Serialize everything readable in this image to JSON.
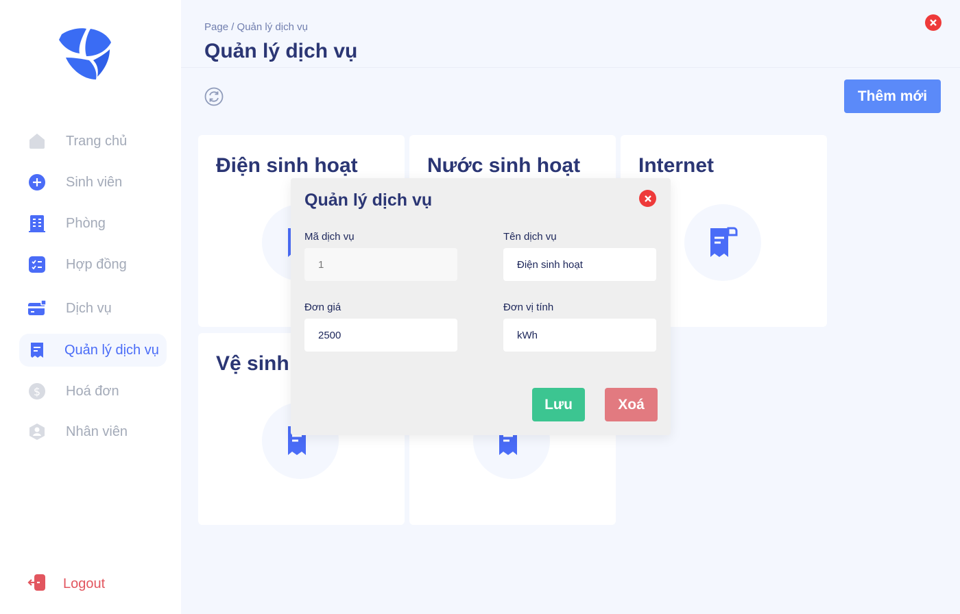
{
  "sidebar": {
    "items": [
      {
        "label": "Trang chủ",
        "icon": "home-icon"
      },
      {
        "label": "Sinh viên",
        "icon": "plus-circle-icon"
      },
      {
        "label": "Phòng",
        "icon": "building-icon"
      },
      {
        "label": "Hợp đồng",
        "icon": "checklist-icon"
      },
      {
        "label": "Dịch vụ",
        "icon": "card-icon"
      },
      {
        "label": "Quản lý dịch vụ",
        "icon": "receipt-icon"
      },
      {
        "label": "Hoá đơn",
        "icon": "dollar-icon"
      },
      {
        "label": "Nhân viên",
        "icon": "user-shield-icon"
      }
    ],
    "active_index": 5,
    "logout_label": "Logout"
  },
  "header": {
    "breadcrumb": "Page / Quản lý dịch vụ",
    "title": "Quản lý dịch vụ"
  },
  "toolbar": {
    "add_label": "Thêm mới"
  },
  "cards": [
    {
      "title": "Điện sinh hoạt"
    },
    {
      "title": "Nước sinh hoạt"
    },
    {
      "title": "Internet"
    },
    {
      "title": "Vệ sinh"
    },
    {
      "title": ""
    }
  ],
  "modal": {
    "title": "Quản lý dịch vụ",
    "fields": {
      "code": {
        "label": "Mã dịch vụ",
        "value": "1"
      },
      "name": {
        "label": "Tên dịch vụ",
        "value": "Điện sinh hoạt"
      },
      "price": {
        "label": "Đơn giá",
        "value": "2500"
      },
      "unit": {
        "label": "Đơn vị tính",
        "value": "kWh"
      }
    },
    "save_label": "Lưu",
    "delete_label": "Xoá"
  },
  "colors": {
    "accent": "#4a6cf7",
    "title": "#2b3674",
    "save": "#3cc591",
    "delete": "#e27a80",
    "close": "#ee3a3a"
  }
}
